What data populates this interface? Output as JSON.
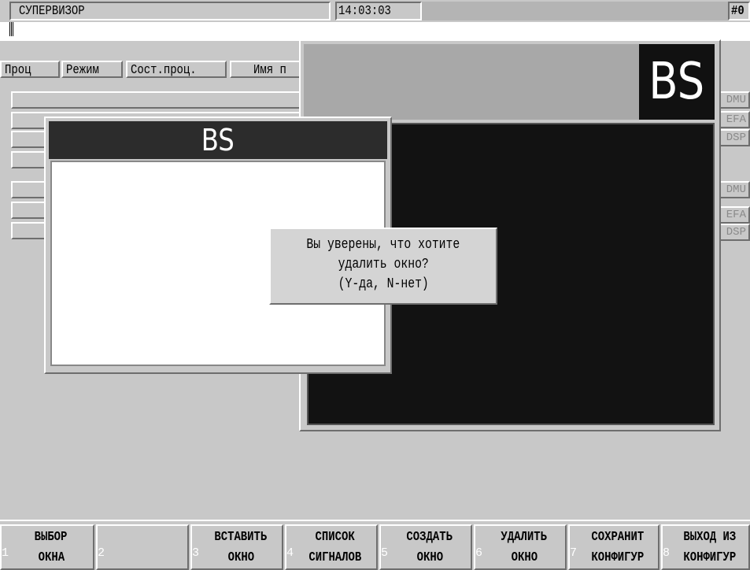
{
  "titlebar": {
    "title": "СУПЕРВИЗОР",
    "time": "14:03:03",
    "corner": "#0"
  },
  "columns": [
    "Проц",
    "Режим",
    "Сост.проц.",
    "Имя п"
  ],
  "side_buttons": [
    "DMU",
    "EFA",
    "DSP",
    "DMU",
    "EFA",
    "DSP"
  ],
  "back_window": {
    "title": "BS"
  },
  "front_window": {
    "title": "BS"
  },
  "dialog": {
    "line1": "Вы уверены, что хотите",
    "line2": "удалить окно?",
    "line3": "(Y-да, N-нет)"
  },
  "fkeys": [
    {
      "num": "1",
      "line1": "ВЫБОР",
      "line2": "ОКНА"
    },
    {
      "num": "2",
      "line1": "",
      "line2": ""
    },
    {
      "num": "3",
      "line1": "ВСТАВИТЬ",
      "line2": "ОКНО"
    },
    {
      "num": "4",
      "line1": "СПИСОК",
      "line2": "СИГНАЛОВ"
    },
    {
      "num": "5",
      "line1": "СОЗДАТЬ",
      "line2": "ОКНО"
    },
    {
      "num": "6",
      "line1": "УДАЛИТЬ",
      "line2": "ОКНО"
    },
    {
      "num": "7",
      "line1": "СОХРАНИТ",
      "line2": "КОНФИГУР"
    },
    {
      "num": "8",
      "line1": "ВЫХОД ИЗ",
      "line2": "КОНФИГУР"
    }
  ]
}
